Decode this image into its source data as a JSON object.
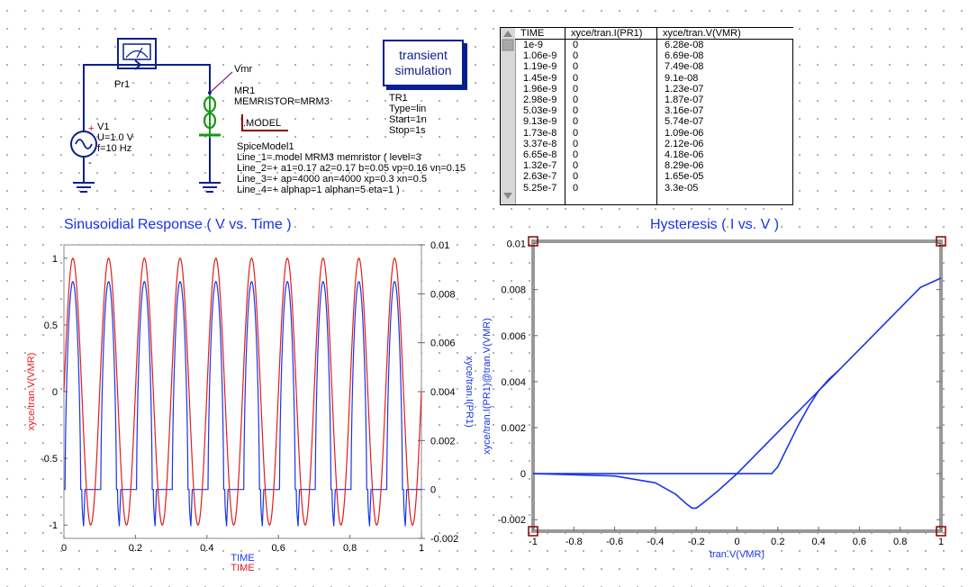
{
  "schematic": {
    "probe": {
      "label": "Pr1"
    },
    "source": {
      "name": "V1",
      "voltage": "U=1.0 V",
      "freq": "f=10 Hz"
    },
    "node_label": "Vmr",
    "memristor": {
      "name": "MR1",
      "param": "MEMRISTOR=MRM3"
    },
    "model_keyword": ".MODEL",
    "spice_model": {
      "name": "SpiceModel1",
      "lines": [
        "Line_1=.model MRM3 memristor ( level=3",
        "Line_2=+ a1=0.17 a2=0.17 b=0.05 vp=0.16 vn=0.15",
        "Line_3=+ ap=4000 an=4000 xp=0.3 xn=0.5",
        "Line_4=+ alphap=1 alphan=5 eta=1 )"
      ]
    },
    "transient": {
      "box_line1": "transient",
      "box_line2": "simulation",
      "name": "TR1",
      "params": [
        "Type=lin",
        "Start=1n",
        "Stop=1s"
      ]
    }
  },
  "table": {
    "headers": [
      "TIME",
      "xyce/tran.I(PR1)",
      "xyce/tran.V(VMR)"
    ],
    "rows": [
      [
        "1e-9",
        "0",
        "6.28e-08"
      ],
      [
        "1.06e-9",
        "0",
        "6.69e-08"
      ],
      [
        "1.19e-9",
        "0",
        "7.49e-08"
      ],
      [
        "1.45e-9",
        "0",
        "9.1e-08"
      ],
      [
        "1.96e-9",
        "0",
        "1.23e-07"
      ],
      [
        "2.98e-9",
        "0",
        "1.87e-07"
      ],
      [
        "5.03e-9",
        "0",
        "3.16e-07"
      ],
      [
        "9.13e-9",
        "0",
        "5.74e-07"
      ],
      [
        "1.73e-8",
        "0",
        "1.09e-06"
      ],
      [
        "3.37e-8",
        "0",
        "2.12e-06"
      ],
      [
        "6.65e-8",
        "0",
        "4.18e-06"
      ],
      [
        "1.32e-7",
        "0",
        "8.29e-06"
      ],
      [
        "2.63e-7",
        "0",
        "1.65e-05"
      ],
      [
        "5.25e-7",
        "0",
        "3.3e-05"
      ]
    ]
  },
  "colors": {
    "red": "#e21d1d",
    "blue": "#1a35e6",
    "wire": "#0a1f8f",
    "green": "#159a15"
  },
  "chart_data": [
    {
      "type": "line",
      "title": "Sinusoidial Response ( V vs. Time )",
      "xlabel": [
        "TIME",
        "TIME"
      ],
      "ylabel_left": "xyce/tran.V(VMR)",
      "ylabel_right": "xyce/tran.I(PR1)",
      "xlim": [
        0,
        1
      ],
      "ylim_left": [
        -1.1,
        1.1
      ],
      "ylim_right": [
        -0.002,
        0.01
      ],
      "x_ticks": [
        "0",
        "0.2",
        "0.4",
        "0.6",
        "0.8",
        "1"
      ],
      "y_ticks_left": [
        "1",
        "0.5",
        "0",
        "-0.5",
        "-1"
      ],
      "y_ticks_right": [
        "0.01",
        "0.008",
        "0.006",
        "0.004",
        "0.002",
        "0",
        "-0.002"
      ],
      "series": [
        {
          "color": "#e21d1d",
          "axis": "left",
          "waveform": "sin",
          "amplitude": 1,
          "frequency": 10
        },
        {
          "color": "#1a35e6",
          "axis": "right",
          "waveform": "memristor current",
          "peak": 0.0085,
          "trough": -0.0015
        }
      ]
    },
    {
      "type": "line",
      "title": "Hysteresis ( I vs. V )",
      "xlabel": "tran.V(VMR)",
      "ylabel": "xyce/tran.I(PR1)@tran.V(VMR)",
      "xlim": [
        -1,
        1
      ],
      "ylim": [
        -0.0025,
        0.0101
      ],
      "x_ticks": [
        "-1",
        "-0.8",
        "-0.6",
        "-0.4",
        "-0.2",
        "0",
        "0.2",
        "0.4",
        "0.6",
        "0.8",
        "1"
      ],
      "y_ticks": [
        "0.01",
        "0.008",
        "0.006",
        "0.004",
        "0.002",
        "0",
        "-0.002"
      ],
      "series": [
        {
          "color": "#1a35e6",
          "x": [
            -1,
            -0.6,
            -0.4,
            -0.3,
            -0.25,
            -0.22,
            -0.2,
            -0.17,
            -0.1,
            0,
            0.1,
            0.2,
            0.3,
            0.4,
            0.5,
            0.6,
            0.7,
            0.8,
            0.9,
            1
          ],
          "y": [
            0,
            -0.0001,
            -0.0004,
            -0.0009,
            -0.0013,
            -0.0015,
            -0.0015,
            -0.0013,
            -0.0008,
            0,
            0.0009,
            0.0018,
            0.0027,
            0.0036,
            0.0045,
            0.0054,
            0.0063,
            0.0072,
            0.0081,
            0.0085
          ]
        },
        {
          "color": "#1a35e6",
          "x": [
            -1,
            0,
            0.1,
            0.17,
            0.2,
            0.25,
            0.3,
            0.35,
            0.4,
            0.45,
            0.5
          ],
          "y": [
            0,
            0,
            0,
            0,
            0.0003,
            0.0012,
            0.0021,
            0.0029,
            0.0036,
            0.0041,
            0.0045
          ]
        }
      ]
    }
  ]
}
